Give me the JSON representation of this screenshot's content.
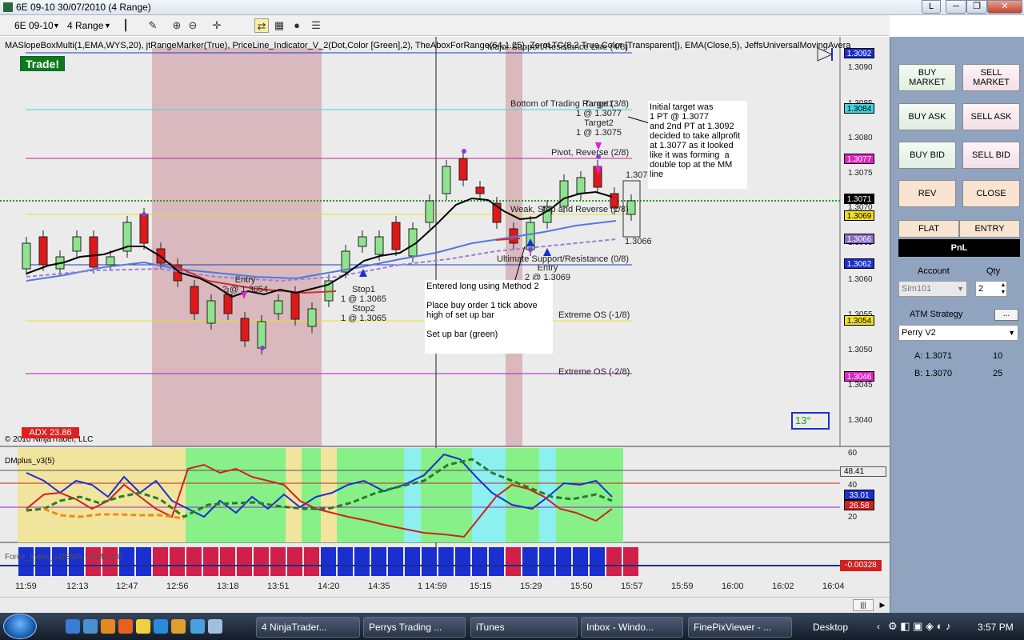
{
  "window": {
    "title": "6E 09-10  30/07/2010 (4 Range)"
  },
  "toolbar": {
    "instrument": "6E 09-10",
    "period": "4 Range"
  },
  "indicator_line": "MASlopeBoxMulti(1,EMA,WYS,20), jtRangeMarker(True), PriceLine_Indicator_V_2(Dot,Color [Green],2), TheAboxForRange(64,1.25), ZeroLTC(8.2,True,Color [Transparent]), EMA(Close,5), JeffsUniversalMovingAvera",
  "trade_badge": "Trade!",
  "copyright": "© 2010 NinjaTrader, LLC",
  "adx": "ADX 23.86",
  "temp": "13°",
  "levels": {
    "major_sr": "Major Support/Resistance Line (4/8)",
    "bottom_range": "Bottom of Trading Range (3/8)",
    "pivot": "Pivot, Reverse (2/8)",
    "weak": "Weak, Stop and Reverse (1/8)",
    "ultimate": "Ultimate Support/Resistance (0/8)",
    "ext_os1": "Extreme OS (-1/8)",
    "ext_os2": "Extreme OS (-2/8)"
  },
  "price_axis": [
    "1.3090",
    "1.3085",
    "1.3080",
    "1.3075",
    "1.3070",
    "1.3065",
    "1.3060",
    "1.3055",
    "1.3050",
    "1.3045",
    "1.3040"
  ],
  "price_tags": {
    "p1": "1.3092",
    "p2": "1.3084",
    "p3": "1.3077",
    "p4": "1.3071",
    "p5": "1.3069",
    "p6": "1.3066",
    "p7": "1.3062",
    "p8": "1.3054",
    "p9": "1.3046"
  },
  "annotations": {
    "entry1": "Entry\n2 @ 1.3054",
    "stop1": "Stop1\n1 @ 1.3065\nStop2\n1 @ 1.3065",
    "target1": "Target1\n1 @ 1.3077\nTarget2\n1 @ 1.3075",
    "entry2": "Entry\n2 @ 1.3069",
    "hi": "1.3074",
    "lo": "1.3066"
  },
  "notes": {
    "target_note": "Initial target was\n1 PT @ 1.3077\nand 2nd PT at 1.3092\ndecided to take allprofit\nat 1.3077 as it looked\nlike it was forming  a\ndouble top at the MM\nline",
    "entry_note": "Entered long using Method 2\n\nPlace buy order 1 tick above\nhigh of set up bar\n\nSet up bar (green)"
  },
  "dmplus": {
    "label": "DMplus_v3(5)",
    "axis": [
      "60",
      "40",
      "20"
    ],
    "tags": {
      "t1": "48.41",
      "t2": "33.01",
      "t3": "26.58"
    }
  },
  "force": {
    "label": "Force_Index_v2(EMA,7,EMA,13)",
    "tag": "-0.00328"
  },
  "time_axis": [
    "11:59",
    "12:13",
    "12:47",
    "12:56",
    "13:18",
    "13:51",
    "14:20",
    "14:35",
    "1 14:59",
    "15:15",
    "15:29",
    "15:50",
    "15:57",
    "15:59",
    "16:00",
    "16:02",
    "16:04"
  ],
  "panel": {
    "buy_market": "BUY\nMARKET",
    "sell_market": "SELL\nMARKET",
    "buy_ask": "BUY ASK",
    "sell_ask": "SELL ASK",
    "buy_bid": "BUY BID",
    "sell_bid": "SELL BID",
    "rev": "REV",
    "close": "CLOSE",
    "flat": "FLAT",
    "entry": "ENTRY",
    "pnl": "PnL",
    "account_label": "Account",
    "qty_label": "Qty",
    "account": "Sim101",
    "qty": "2",
    "atm_label": "ATM Strategy",
    "atm_more": "...",
    "atm": "Perry V2",
    "a_label": "A: 1.3071",
    "a_qty": "10",
    "b_label": "B: 1.3070",
    "b_qty": "25"
  },
  "taskbar": {
    "items": [
      "4 NinjaTrader...",
      "Perrys Trading ...",
      "iTunes",
      "Inbox - Windo...",
      "FinePixViewer - ..."
    ],
    "desktop": "Desktop",
    "clock": "3:57 PM"
  }
}
